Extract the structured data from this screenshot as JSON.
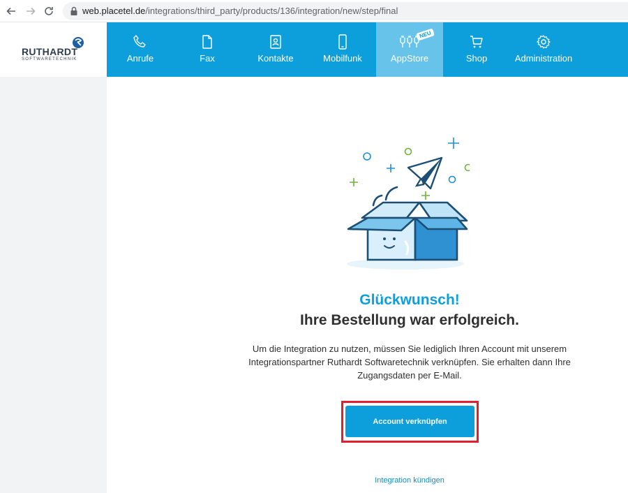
{
  "browser": {
    "url_host": "web.placetel.de",
    "url_path": "/integrations/third_party/products/136/integration/new/step/final"
  },
  "brand": {
    "name": "RUTHARDT",
    "subtitle": "SOFTWARETECHNIK",
    "primary_color": "#0c9fdb",
    "active_tab_color": "#67c3ea",
    "highlight_color": "#e0202e"
  },
  "nav": {
    "items": [
      {
        "label": "Anrufe",
        "icon": "phone-icon"
      },
      {
        "label": "Fax",
        "icon": "document-icon"
      },
      {
        "label": "Kontakte",
        "icon": "contacts-icon"
      },
      {
        "label": "Mobilfunk",
        "icon": "mobile-icon"
      },
      {
        "label": "AppStore",
        "icon": "plug-icon",
        "active": true,
        "badge": "NEU"
      },
      {
        "label": "Shop",
        "icon": "cart-icon"
      },
      {
        "label": "Administration",
        "icon": "gear-icon"
      }
    ]
  },
  "main": {
    "headline": "Glückwunsch!",
    "subline": "Ihre Bestellung war erfolgreich.",
    "description": "Um die Integration zu nutzen, müssen Sie lediglich Ihren Account mit unserem Integrationspartner Ruthardt Softwaretechnik verknüpfen. Sie erhalten dann Ihre Zugangsdaten per E-Mail.",
    "button_label": "Account verknüpfen",
    "cancel_label": "Integration kündigen"
  }
}
